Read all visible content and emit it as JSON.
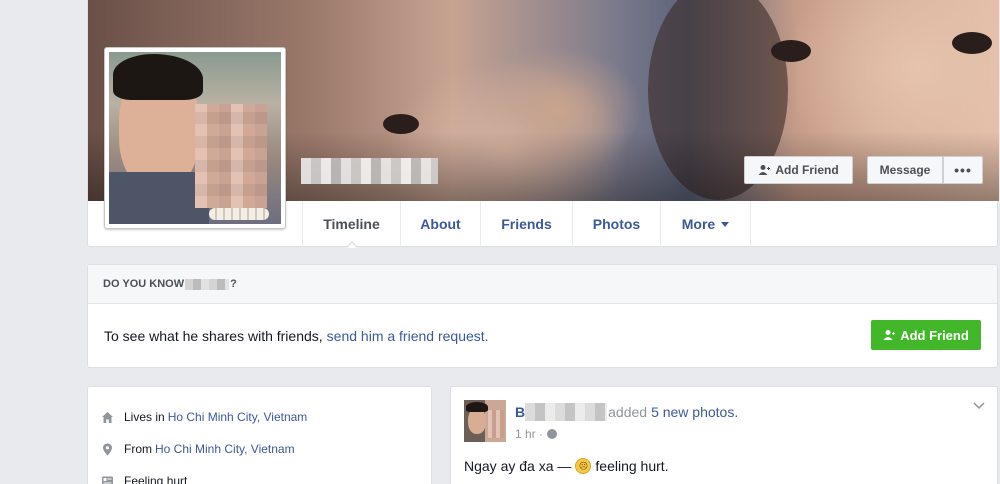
{
  "profile": {
    "name_redacted": ""
  },
  "cover_buttons": {
    "add_friend": "Add Friend",
    "message": "Message",
    "more": "•••"
  },
  "tabs": [
    {
      "label": "Timeline",
      "active": true
    },
    {
      "label": "About"
    },
    {
      "label": "Friends"
    },
    {
      "label": "Photos"
    },
    {
      "label": "More"
    }
  ],
  "know_card": {
    "heading_prefix": "DO YOU KNOW",
    "heading_suffix": "?",
    "body_text": "To see what he shares with friends,",
    "link_text": "send him a friend request.",
    "button_label": "Add Friend"
  },
  "about": {
    "items": [
      {
        "icon": "house-icon",
        "prefix": "Lives in",
        "link": "Ho Chi Minh City, Vietnam"
      },
      {
        "icon": "location-pin-icon",
        "prefix": "From",
        "link": "Ho Chi Minh City, Vietnam"
      },
      {
        "icon": "feeling-icon",
        "prefix": "Feeling hurt",
        "link": ""
      }
    ]
  },
  "post": {
    "author_initial": "B",
    "action": "added",
    "photos_link": "5 new photos.",
    "time": "1 hr ·",
    "text_before": "Ngay ay đa xa —",
    "text_after": "feeling hurt."
  },
  "colors": {
    "link_blue": "#3b5998",
    "green_button": "#42b72a",
    "background": "#e9eaed"
  }
}
